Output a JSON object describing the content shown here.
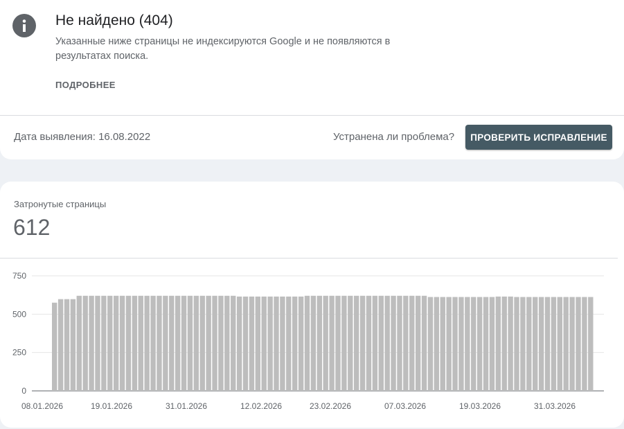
{
  "issue": {
    "title": "Не найдено (404)",
    "description": "Указанные ниже страницы не индексируются Google и не появляются в результатах поиска.",
    "more_label": "ПОДРОБНЕЕ",
    "detected_label": "Дата выявления: 16.08.2022",
    "fixed_question": "Устранена ли проблема?",
    "check_fix_label": "ПРОВЕРИТЬ ИСПРАВЛЕНИЕ"
  },
  "summary": {
    "affected_label": "Затронутые страницы",
    "affected_value": "612"
  },
  "colors": {
    "bar": "#bdbdbd",
    "button": "#455a64",
    "icon": "#5f6368"
  },
  "chart_data": {
    "type": "bar",
    "x_ticks": [
      "08.01.2026",
      "19.01.2026",
      "31.01.2026",
      "12.02.2026",
      "23.02.2026",
      "07.03.2026",
      "19.03.2026",
      "31.03.2026"
    ],
    "y_ticks": [
      "0",
      "250",
      "500",
      "750"
    ],
    "ylim": [
      0,
      750
    ],
    "grid": true,
    "values": [
      575,
      598,
      598,
      598,
      620,
      620,
      620,
      620,
      620,
      620,
      620,
      620,
      620,
      620,
      620,
      620,
      620,
      620,
      620,
      620,
      620,
      620,
      620,
      620,
      620,
      620,
      620,
      620,
      620,
      620,
      615,
      615,
      615,
      615,
      615,
      615,
      615,
      615,
      615,
      615,
      615,
      620,
      620,
      620,
      620,
      620,
      620,
      620,
      620,
      620,
      620,
      620,
      620,
      620,
      620,
      620,
      620,
      620,
      620,
      620,
      620,
      612,
      612,
      612,
      612,
      612,
      612,
      612,
      612,
      612,
      612,
      612,
      615,
      615,
      615,
      612,
      612,
      612,
      612,
      612,
      612,
      612,
      612,
      612,
      612,
      612,
      612,
      612
    ]
  }
}
